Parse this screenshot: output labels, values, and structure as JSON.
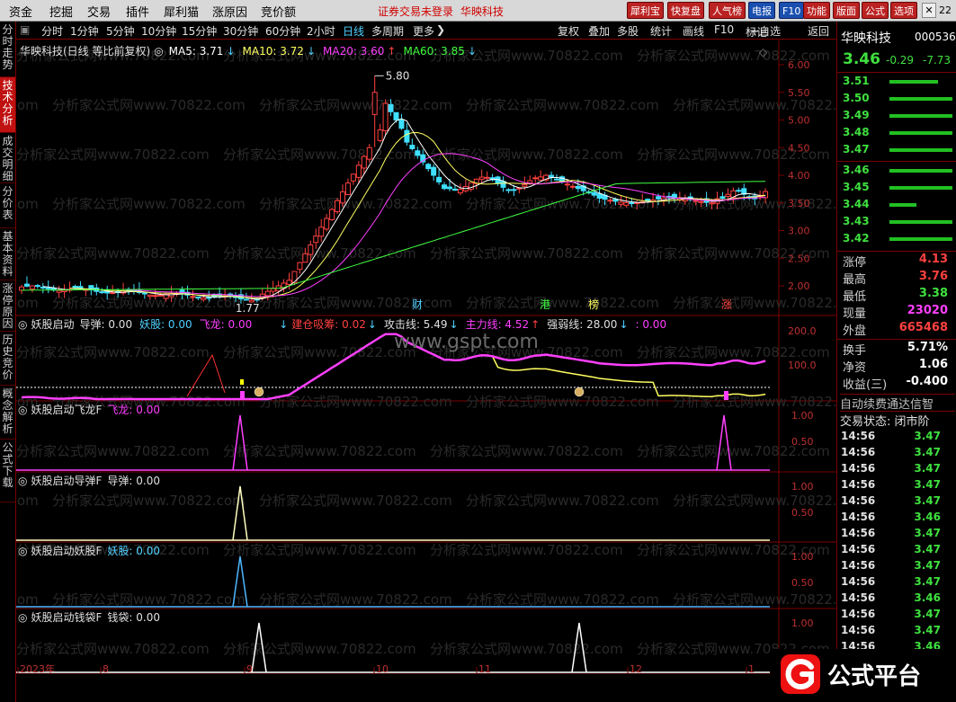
{
  "menu": {
    "items": [
      "资金",
      "挖掘",
      "交易",
      "插件",
      "犀利猫",
      "涨原因",
      "竞价额"
    ],
    "status_text": "证券交易未登录",
    "stock_name_top": "华映科技",
    "top_buttons": [
      "犀利宝",
      "快复盘",
      "人气榜",
      "电报",
      "F10",
      "功能",
      "版面",
      "公式",
      "选项"
    ],
    "win_label": "22"
  },
  "periods": {
    "items": [
      "分时",
      "1分钟",
      "5分钟",
      "10分钟",
      "15分钟",
      "30分钟",
      "60分钟",
      "2小时",
      "日线",
      "多周期",
      "更多"
    ],
    "active_index": 8,
    "right_tools": [
      "复权",
      "叠加",
      "多股",
      "统计",
      "画线",
      "F10",
      "+自选",
      "返回"
    ]
  },
  "left_tabs": [
    {
      "label": "分时走势",
      "active": false
    },
    {
      "label": "技术分析",
      "active": true
    },
    {
      "label": "成交明细",
      "active": false
    },
    {
      "label": "分价表",
      "active": false
    },
    {
      "label": "基本资料",
      "active": false
    },
    {
      "label": "涨停原因",
      "active": false
    },
    {
      "label": "历史竞价",
      "active": false
    },
    {
      "label": "概念解析",
      "active": false
    },
    {
      "label": "公式下载",
      "active": false
    }
  ],
  "main_panel": {
    "title": "华映科技(日线 等比前复权)",
    "ma": [
      {
        "label": "MA5: 3.71",
        "color": "#ffffff"
      },
      {
        "label": "MA10: 3.72",
        "color": "#ffff60"
      },
      {
        "label": "MA20: 3.60",
        "color": "#ff40ff"
      },
      {
        "label": "MA60: 3.85",
        "color": "#40ff40"
      }
    ],
    "mark_label": "标记",
    "high_label": "5.80",
    "low_label": "1.77",
    "y_axis": [
      "6.00",
      "5.50",
      "5.00",
      "4.50",
      "4.00",
      "3.50",
      "3.00",
      "2.50",
      "2.00"
    ],
    "events": [
      {
        "label": "财",
        "color": "#4fd0ff"
      },
      {
        "label": "港",
        "color": "#40ff40"
      },
      {
        "label": "榜",
        "color": "#ffff60"
      },
      {
        "label": "涨",
        "color": "#ff4040"
      }
    ]
  },
  "panels": {
    "p1": {
      "title": "妖股启动",
      "items": [
        {
          "label": "导弹: 0.00",
          "color": "#e0e0e0"
        },
        {
          "label": "妖股: 0.00",
          "color": "#4fd0ff"
        },
        {
          "label": "飞龙: 0.00",
          "color": "#ff40ff"
        },
        {
          "label": "建仓吸筹: 0.02",
          "color": "#ff4040"
        },
        {
          "label": "攻击线: 5.49",
          "color": "#e0e0e0"
        },
        {
          "label": "主力线: 4.52",
          "color": "#ff40ff"
        },
        {
          "label": "强弱线: 28.00",
          "color": "#e0e0e0"
        },
        {
          "label": ": 0.00",
          "color": "#ff40ff"
        }
      ],
      "y_axis": [
        "200.0",
        "100.0"
      ],
      "watermark": "www.gspt.com"
    },
    "p2": {
      "title": "妖股启动飞龙F",
      "item": "飞龙: 0.00",
      "color": "#ff40ff",
      "y_axis": [
        "1.00",
        "0.50"
      ]
    },
    "p3": {
      "title": "妖股启动导弹F",
      "item": "导弹: 0.00",
      "color": "#e0e0e0",
      "y_axis": [
        "1.00",
        "0.50"
      ]
    },
    "p4": {
      "title": "妖股启动妖股F",
      "item": "妖股: 0.00",
      "color": "#4fd0ff",
      "y_axis": [
        "1.00",
        "0.50"
      ]
    },
    "p5": {
      "title": "妖股启动钱袋F",
      "item": "钱袋: 0.00",
      "color": "#e0e0e0",
      "y_axis": [
        "1.00"
      ]
    }
  },
  "date_axis": [
    "2023年",
    "8",
    "9",
    "10",
    "11",
    "12",
    "1"
  ],
  "watermark_text": "分析家公式网www.70822.com",
  "right_panel": {
    "name": "华映科技",
    "code": "000536",
    "price": "3.46",
    "change": "-0.29",
    "pct": "-7.73",
    "sells": [
      {
        "price": "3.51",
        "bar": 54
      },
      {
        "price": "3.50",
        "bar": 70
      },
      {
        "price": "3.49",
        "bar": 70
      },
      {
        "price": "3.48",
        "bar": 70
      },
      {
        "price": "3.47",
        "bar": 70
      }
    ],
    "buys": [
      {
        "price": "3.46",
        "bar": 70
      },
      {
        "price": "3.45",
        "bar": 70
      },
      {
        "price": "3.44",
        "bar": 30
      },
      {
        "price": "3.43",
        "bar": 70
      },
      {
        "price": "3.42",
        "bar": 70
      }
    ],
    "stats1": [
      {
        "k": "涨停",
        "v": "4.13",
        "color": "#ff4040"
      },
      {
        "k": "最高",
        "v": "3.76",
        "color": "#ff4040"
      },
      {
        "k": "最低",
        "v": "3.38",
        "color": "#3fe03f"
      },
      {
        "k": "现量",
        "v": "23020",
        "color": "#ff40ff"
      },
      {
        "k": "外盘",
        "v": "665468",
        "color": "#ff4040"
      }
    ],
    "stats2": [
      {
        "k": "换手",
        "v": "5.71%",
        "color": "#ffffff"
      },
      {
        "k": "净资",
        "v": "1.06",
        "color": "#ffffff"
      },
      {
        "k": "收益(三)",
        "v": "-0.400",
        "color": "#ffffff"
      }
    ],
    "auto_text": "自动续费通达信智",
    "trade_state": "交易状态: 闭市阶",
    "ticks": [
      {
        "t": "14:56",
        "p": "3.47"
      },
      {
        "t": "14:56",
        "p": "3.47"
      },
      {
        "t": "14:56",
        "p": "3.47"
      },
      {
        "t": "14:56",
        "p": "3.47"
      },
      {
        "t": "14:56",
        "p": "3.47"
      },
      {
        "t": "14:56",
        "p": "3.46"
      },
      {
        "t": "14:56",
        "p": "3.47"
      },
      {
        "t": "14:56",
        "p": "3.47"
      },
      {
        "t": "14:56",
        "p": "3.47"
      },
      {
        "t": "14:56",
        "p": "3.47"
      },
      {
        "t": "14:56",
        "p": "3.46"
      },
      {
        "t": "14:56",
        "p": "3.47"
      },
      {
        "t": "14:56",
        "p": "3.47"
      },
      {
        "t": "14:56",
        "p": "3.46"
      },
      {
        "t": "14:56",
        "p": "3.47"
      }
    ]
  },
  "logo": {
    "text": "公式平台"
  },
  "colors": {
    "up": "#ff4040",
    "down": "#3fe0ff",
    "bg": "#000000",
    "grid": "#7a0000"
  }
}
